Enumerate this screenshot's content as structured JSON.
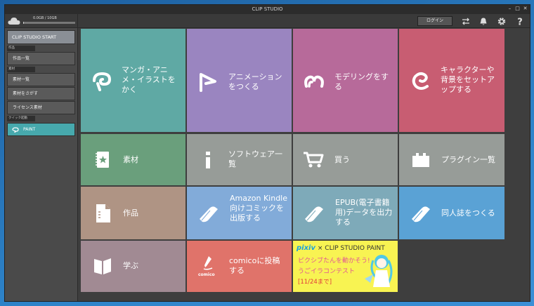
{
  "window": {
    "title": "CLIP STUDIO"
  },
  "storage": {
    "text": "0.0GB / 10GB",
    "fraction": 0.02
  },
  "sidebar": {
    "start": "CLIP STUDIO START",
    "sections": {
      "works": "作品",
      "materials": "素材",
      "quick": "クイック起動"
    },
    "items": {
      "works_list": "作品一覧",
      "materials_list": "素材一覧",
      "materials_search": "素材をさがす",
      "license_materials": "ライセンス素材",
      "paint": "PAINT"
    }
  },
  "toolbar": {
    "login": "ログイン"
  },
  "tiles": {
    "manga": "マンガ・アニメ・イラストをかく",
    "anim": "アニメーションをつくる",
    "model": "モデリングをする",
    "chara": "キャラクターや背景をセットアップする",
    "sozai": "素材",
    "software": "ソフトウェア一覧",
    "buy": "買う",
    "plugin": "プラグイン一覧",
    "works": "作品",
    "kindle": "Amazon Kindle向けコミックを出版する",
    "epub": "EPUB(電子書籍用)データを出力する",
    "doujin": "同人誌をつくる",
    "learn": "学ぶ",
    "comico": "comicoに投稿する",
    "comico_logo": "comico"
  },
  "pixiv": {
    "brand": "pixiv",
    "cross": "×",
    "partner": "CLIP STUDIO PAINT",
    "line1": "ピクシブたんを動かそう!",
    "line2": "うごイラコンテスト",
    "line3": "[11/24まで]"
  },
  "colors": {
    "manga": "#5fa9a4",
    "anim": "#9a85c0",
    "model": "#b76a9a",
    "chara": "#c85d72",
    "sozai": "#6a9f7c",
    "software": "#979c98",
    "buy": "#979c98",
    "plugin": "#979c98",
    "works": "#af9484",
    "kindle": "#82abd9",
    "epub": "#7eaab9",
    "doujin": "#5aa2d5",
    "learn": "#a18a93",
    "comico": "#e0736a"
  }
}
